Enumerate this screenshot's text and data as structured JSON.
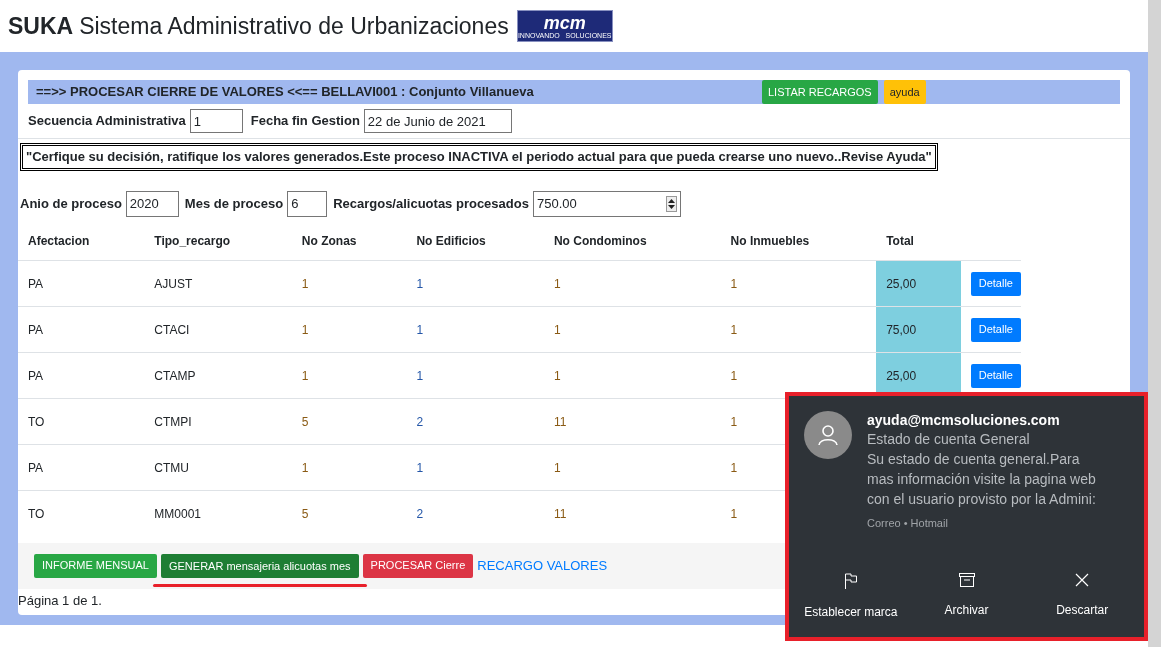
{
  "header": {
    "brand": "SUKA",
    "title": "Sistema Administrativo de Urbanizaciones",
    "logo_text": "mcm",
    "logo_tagline": "INNOVANDO   SOLUCIONES"
  },
  "panel": {
    "heading": "==>> PROCESAR CIERRE DE VALORES <<== BELLAVI001 : Conjunto Villanueva",
    "buttons": [
      {
        "label": "LISTAR RECARGOS",
        "kind": "success"
      },
      {
        "label": "ayuda",
        "kind": "warning"
      }
    ],
    "fields": [
      {
        "label": "Secuencia Administrativa",
        "value": "1"
      },
      {
        "label": "Fecha fin Gestion",
        "value": "22 de Junio de 2021"
      }
    ],
    "notice": "\"Cerfique su decisión, ratifique los valores generados.Este proceso INACTIVA el periodo actual para que pueda crearse uno nuevo..Revise Ayuda\"",
    "process_fields": [
      {
        "label": "Anio de proceso",
        "value": "2020",
        "kind": "text"
      },
      {
        "label": "Mes de proceso",
        "value": "6",
        "kind": "text"
      },
      {
        "label": "Recargos/alicuotas procesados",
        "value": "750.00",
        "kind": "number"
      }
    ]
  },
  "table": {
    "columns": [
      "Afectacion",
      "Tipo_recargo",
      "No Zonas",
      "No Edificios",
      "No Condominos",
      "No Inmuebles",
      "Total"
    ],
    "rows": [
      {
        "cells": [
          "PA",
          "AJUST",
          "1",
          "1",
          "1",
          "1",
          "25,00"
        ],
        "action": "Detalle"
      },
      {
        "cells": [
          "PA",
          "CTACI",
          "1",
          "1",
          "1",
          "1",
          "75,00"
        ],
        "action": "Detalle"
      },
      {
        "cells": [
          "PA",
          "CTAMP",
          "1",
          "1",
          "1",
          "1",
          "25,00"
        ],
        "action": "Detalle"
      },
      {
        "cells": [
          "TO",
          "CTMPI",
          "5",
          "2",
          "11",
          "1"
        ]
      },
      {
        "cells": [
          "PA",
          "CTMU",
          "1",
          "1",
          "1",
          "1"
        ]
      },
      {
        "cells": [
          "TO",
          "MM0001",
          "5",
          "2",
          "11",
          "1"
        ]
      }
    ]
  },
  "actions": [
    {
      "label": "INFORME MENSUAL",
      "kind": "success",
      "underlined": false
    },
    {
      "label": "GENERAR mensajeria alicuotas mes",
      "kind": "dark-success",
      "underlined": true
    },
    {
      "label": "PROCESAR Cierre",
      "kind": "danger",
      "underlined": false
    },
    {
      "label": "RECARGO VALORES",
      "kind": "link",
      "underlined": false
    }
  ],
  "pager": "Página 1 de 1.",
  "notification": {
    "sender": "ayuda@mcmsoluciones.com",
    "subject": "Estado de cuenta General",
    "body": "Su estado de cuenta general.Para mas información visite la pagina web con el usuario provisto por la Admini:",
    "source": "Correo • Hotmail",
    "buttons": [
      {
        "label": "Establecer marca",
        "kind": "flag"
      },
      {
        "label": "Archivar",
        "kind": "archive"
      },
      {
        "label": "Descartar",
        "kind": "close"
      }
    ]
  }
}
